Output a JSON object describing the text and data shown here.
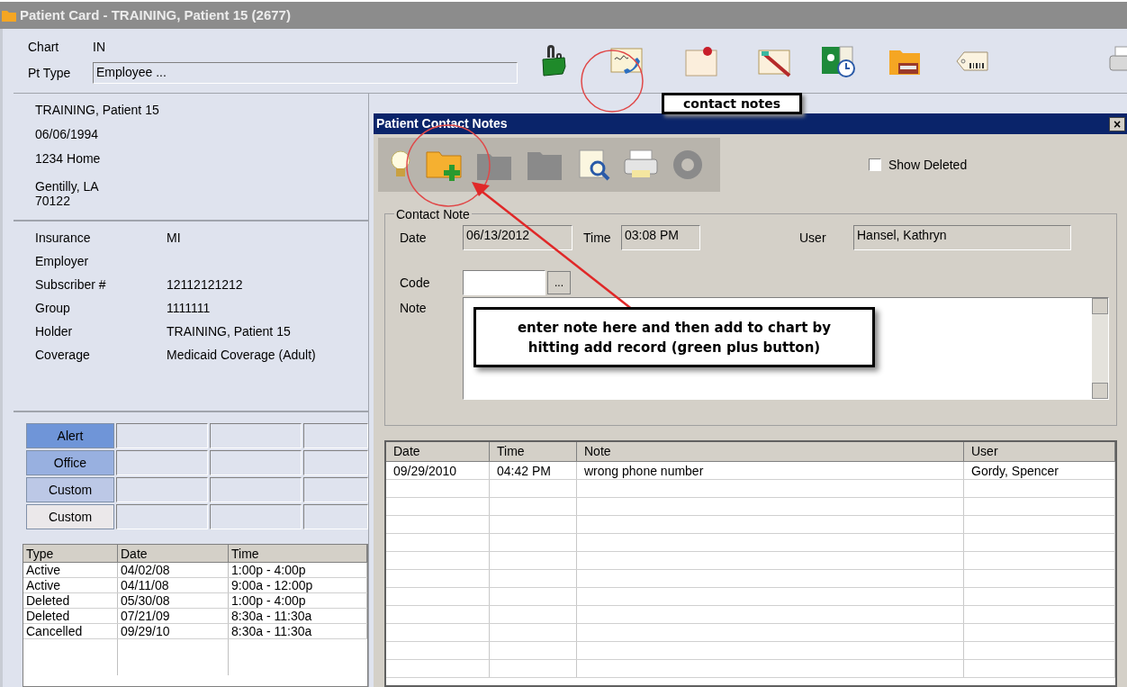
{
  "window": {
    "title": "Patient Card - TRAINING, Patient 15 (2677)"
  },
  "header": {
    "chart": {
      "label": "Chart",
      "value": "IN"
    },
    "pt_type": {
      "label": "Pt Type",
      "value": "Employee ..."
    }
  },
  "patient": {
    "blocks": [
      [
        "TRAINING, Patient 15",
        "06/06/1994",
        "1234 Home"
      ],
      [
        "Gentilly, LA",
        "70122"
      ]
    ]
  },
  "insurance": [
    {
      "label": "Insurance",
      "value": "MI"
    },
    {
      "label": "Employer"
    },
    {
      "label": "Subscriber #",
      "value": "12112121212"
    },
    {
      "label": "Group",
      "value": "1111111"
    },
    {
      "label": "Holder",
      "value": "TRAINING, Patient 15"
    },
    {
      "label": "Coverage",
      "value": "Medicaid Coverage (Adult)"
    }
  ],
  "flags": [
    {
      "label": "Alert",
      "color": "#6f95d8"
    },
    {
      "label": "Office",
      "color": "#98b0e0"
    },
    {
      "label": "Custom",
      "color": "#bcc8e6"
    },
    {
      "label": "Custom",
      "color": "#ebe8ea"
    }
  ],
  "appointments": {
    "columns": [
      "Type",
      "Date",
      "Time"
    ],
    "rows": [
      [
        "Active",
        "04/02/08",
        "1:00p - 4:00p"
      ],
      [
        "Active",
        "04/11/08",
        "9:00a - 12:00p"
      ],
      [
        "Deleted",
        "05/30/08",
        "1:00p - 4:00p"
      ],
      [
        "Deleted",
        "07/21/09",
        "8:30a - 11:30a"
      ],
      [
        "Cancelled",
        "09/29/10",
        "8:30a - 11:30a"
      ]
    ]
  },
  "dialog": {
    "title": "Patient Contact Notes",
    "close": "×",
    "show_deleted": {
      "label": "Show Deleted",
      "checked": false
    },
    "group_title": "Contact Note",
    "date": {
      "label": "Date",
      "value": "06/13/2012"
    },
    "time": {
      "label": "Time",
      "value": "03:08 PM"
    },
    "user": {
      "label": "User",
      "value": "Hansel, Kathryn"
    },
    "code": {
      "label": "Code",
      "button": "..."
    },
    "note": {
      "label": "Note"
    },
    "notes_table": {
      "columns": [
        "Date",
        "Time",
        "Note",
        "User"
      ],
      "rows": [
        [
          "09/29/2010",
          "04:42 PM",
          "wrong phone number",
          "Gordy, Spencer"
        ]
      ]
    }
  },
  "annotations": [
    {
      "text": "contact notes"
    },
    {
      "text": "enter note here and then add to chart by hitting add record (green plus button)"
    }
  ]
}
